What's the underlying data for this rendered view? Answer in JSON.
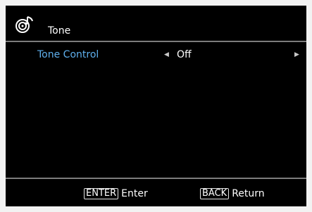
{
  "header": {
    "title": "Tone",
    "icon": "disc-music-icon"
  },
  "settings": [
    {
      "label": "Tone Control",
      "value": "Off"
    }
  ],
  "footer": {
    "enter": {
      "key": "ENTER",
      "label": "Enter"
    },
    "back": {
      "key": "BACK",
      "label": "Return"
    }
  },
  "colors": {
    "background": "#000000",
    "frame": "#f2f2f2",
    "label_accent": "#5fb0ee",
    "divider": "#7c7c7c",
    "text": "#ffffff"
  }
}
